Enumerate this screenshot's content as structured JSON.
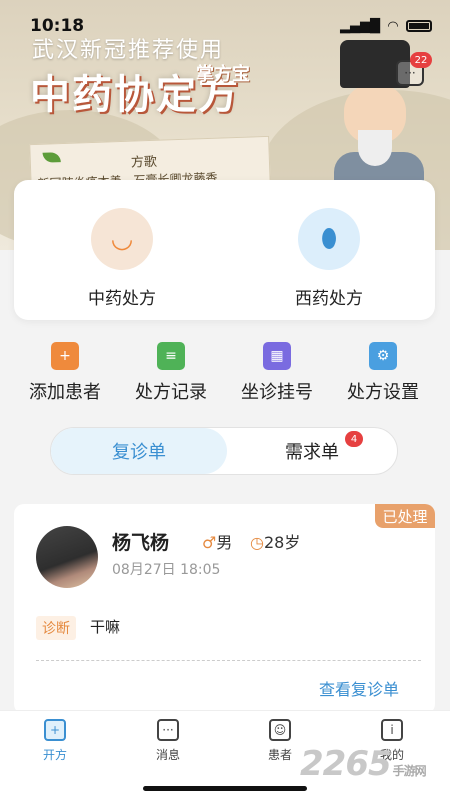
{
  "status_bar": {
    "time": "10:18"
  },
  "banner": {
    "subtitle": "武汉新冠推荐使用",
    "title": "中药协定方",
    "tag": "掌方宝",
    "scroll_title": "方歌",
    "scroll_text": "新冠肺炎疫本善，石膏长卿龙藤香"
  },
  "messages": {
    "icon": "chat-bubble-icon",
    "badge": "22"
  },
  "prescriptions": [
    {
      "label": "中药处方",
      "icon": "herbal-bowl-icon",
      "color": "#f6e5d6"
    },
    {
      "label": "西药处方",
      "icon": "pill-capsule-icon",
      "color": "#dceefb"
    }
  ],
  "tools": [
    {
      "label": "添加患者",
      "icon": "add-patient-icon",
      "color": "#ef8a3c"
    },
    {
      "label": "处方记录",
      "icon": "prescription-record-icon",
      "color": "#4fb257"
    },
    {
      "label": "坐诊挂号",
      "icon": "calendar-icon",
      "color": "#7a6be0"
    },
    {
      "label": "处方设置",
      "icon": "settings-document-icon",
      "color": "#4a9fe0"
    }
  ],
  "segments": {
    "active": "复诊单",
    "other": "需求单",
    "other_badge": "4"
  },
  "order": {
    "status": "已处理",
    "name": "杨飞杨",
    "gender_symbol": "♂",
    "gender": "男",
    "age": "28岁",
    "time": "08月27日 18:05",
    "diag_label": "诊断",
    "diag_text": "干嘛",
    "link": "查看复诊单"
  },
  "tabbar": [
    {
      "label": "开方",
      "icon": "prescribe-icon",
      "active": true
    },
    {
      "label": "消息",
      "icon": "message-icon",
      "active": false
    },
    {
      "label": "患者",
      "icon": "patient-icon",
      "active": false
    },
    {
      "label": "我的",
      "icon": "profile-icon",
      "active": false
    }
  ],
  "watermark": {
    "brand": "2265",
    "suffix": "手游网"
  },
  "colors": {
    "accent": "#3a8fd1",
    "orange": "#e58a40",
    "badge_red": "#e64040"
  }
}
